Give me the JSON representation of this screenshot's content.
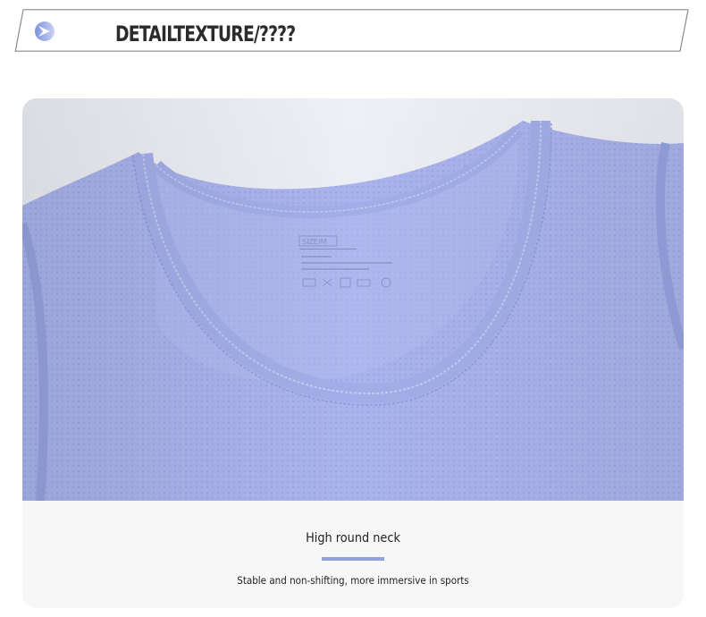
{
  "header": {
    "title": "DETAILTEXTURE/????",
    "icon": "chevron-circle-icon",
    "accent_color": "#7d92dd"
  },
  "photo": {
    "subject": "Lavender mesh athletic vest, round neckline close-up",
    "fabric_color": "#aab4ec",
    "tag": {
      "size_label": "SIZE/M"
    }
  },
  "caption": {
    "title": "High round neck",
    "subtitle": "Stable and non-shifting, more immersive in sports",
    "underline_color": "#8ea2dd"
  }
}
